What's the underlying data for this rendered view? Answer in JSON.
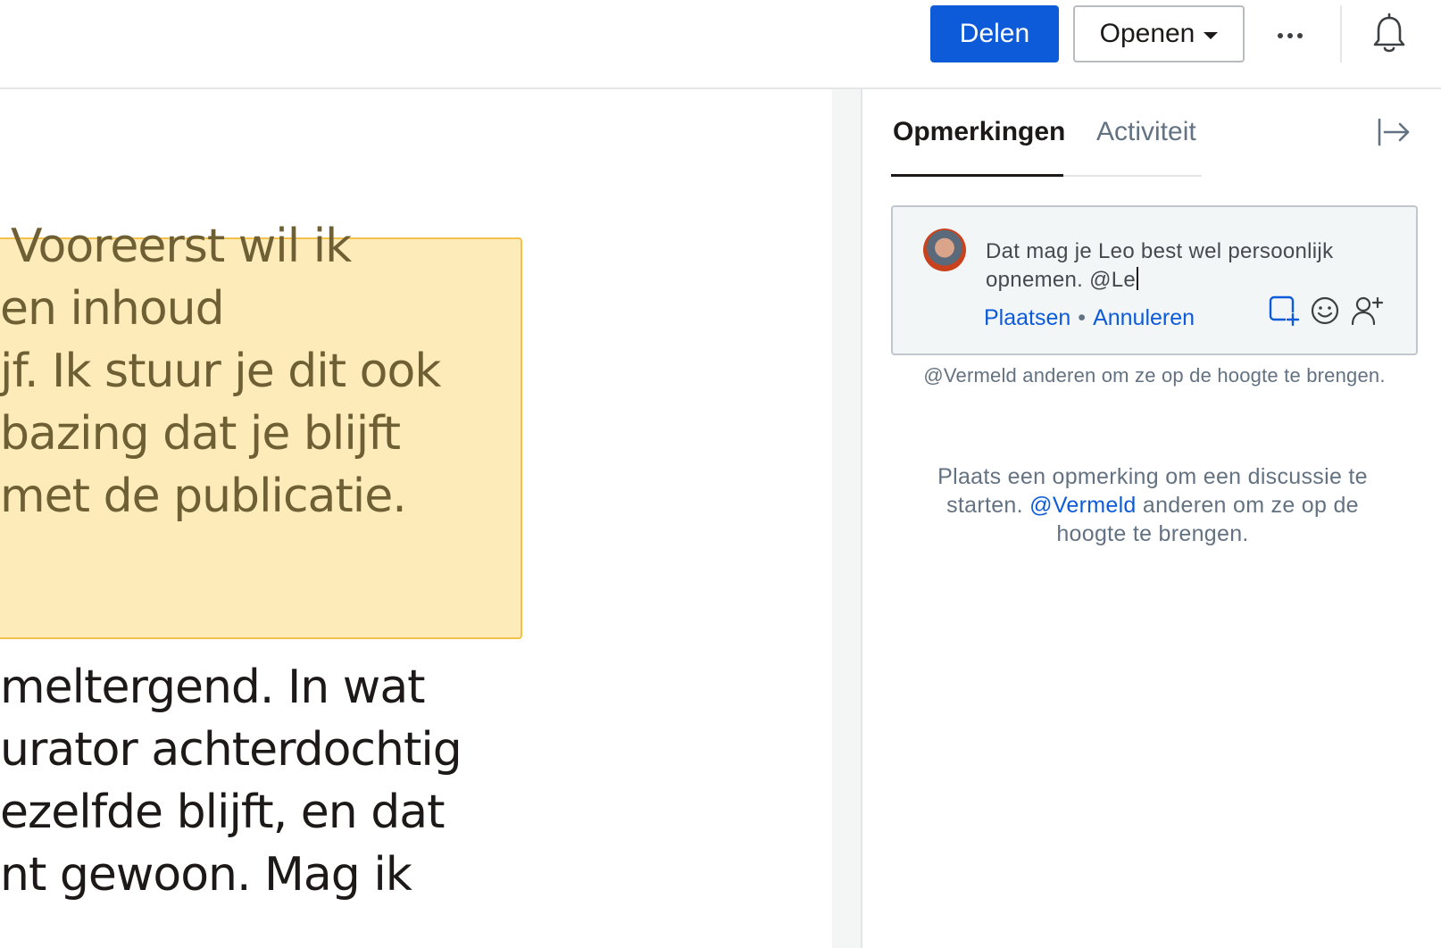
{
  "toolbar": {
    "share_label": "Delen",
    "open_label": "Openen",
    "more_icon": "more-horizontal-icon",
    "bell_icon": "bell-icon"
  },
  "document": {
    "highlighted_lines": [
      "Vooreerst wil ik",
      "en inhoud",
      "jf. Ik stuur je dit ook",
      "bazing dat je blijft",
      "met de publicatie."
    ],
    "body_lines": [
      "meltergend. In wat",
      "urator achterdochtig",
      "ezelfde blijft, en dat",
      "nt gewoon. Mag ik"
    ]
  },
  "panel": {
    "tabs": [
      {
        "label": "Opmerkingen",
        "active": true
      },
      {
        "label": "Activiteit",
        "active": false
      }
    ],
    "collapse_icon": "collapse-panel-icon",
    "draft": {
      "text": "Dat mag je Leo best wel persoonlijk opnemen. @Le",
      "post_label": "Plaatsen",
      "separator": "•",
      "cancel_label": "Annuleren",
      "tools": [
        "add-annotation-icon",
        "emoji-icon",
        "mention-user-icon"
      ]
    },
    "mention_hint": "@Vermeld anderen om ze op de hoogte te brengen.",
    "empty_state": {
      "before": "Plaats een opmerking om een discussie te starten.",
      "mention": "@Vermeld",
      "after": "anderen om ze op de hoogte te brengen."
    }
  },
  "colors": {
    "accent": "#0d5bd9",
    "highlight_fill": "#fdecb9",
    "highlight_border": "#f2c04b"
  }
}
